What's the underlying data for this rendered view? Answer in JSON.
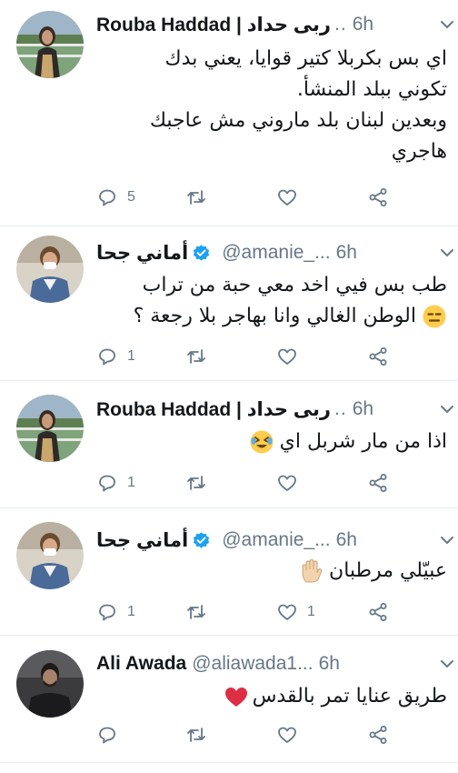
{
  "tweets": [
    {
      "name": "Rouba Haddad | ربى حداد",
      "dots": "..",
      "time": "6h",
      "verified": false,
      "lines": [
        "اي بس بكربلا كتير قوايا، يعني بدك",
        "تكوني ببلد المنشأ.",
        "وبعدين لبنان بلد ماروني مش عاجبك",
        "هاجري"
      ],
      "reply_count": "5",
      "retweet_count": "",
      "like_count": ""
    },
    {
      "name": "أماني جحا",
      "handle": "@amanie_...",
      "time": "6h",
      "verified": true,
      "lines": [
        "طب بس فيي اخد معي حبة من تراب",
        "الوطن الغالي وانا بهاجر بلا رجعة ؟"
      ],
      "reply_count": "1",
      "retweet_count": "",
      "like_count": ""
    },
    {
      "name": "Rouba Haddad | ربى حداد",
      "dots": "..",
      "time": "6h",
      "verified": false,
      "lines": [
        "اذا من مار شربل اي"
      ],
      "reply_count": "1",
      "retweet_count": "",
      "like_count": ""
    },
    {
      "name": "أماني جحا",
      "handle": "@amanie_...",
      "time": "6h",
      "verified": true,
      "lines": [
        "عبيّلي مرطبان"
      ],
      "reply_count": "1",
      "retweet_count": "",
      "like_count": "1"
    },
    {
      "name": "Ali Awada",
      "handle": "@aliawada1...",
      "time": "6h",
      "verified": false,
      "lines": [
        "طريق عنايا تمر بالقدس"
      ],
      "reply_count": "",
      "retweet_count": "",
      "like_count": ""
    }
  ],
  "icons": [
    "reply-icon",
    "retweet-icon",
    "like-icon",
    "share-icon",
    "chevron-down-icon",
    "verified-badge-icon"
  ],
  "colors": {
    "text": "#14171a",
    "muted": "#657786",
    "verified": "#1da1f2",
    "divider": "#e6ecf0"
  }
}
